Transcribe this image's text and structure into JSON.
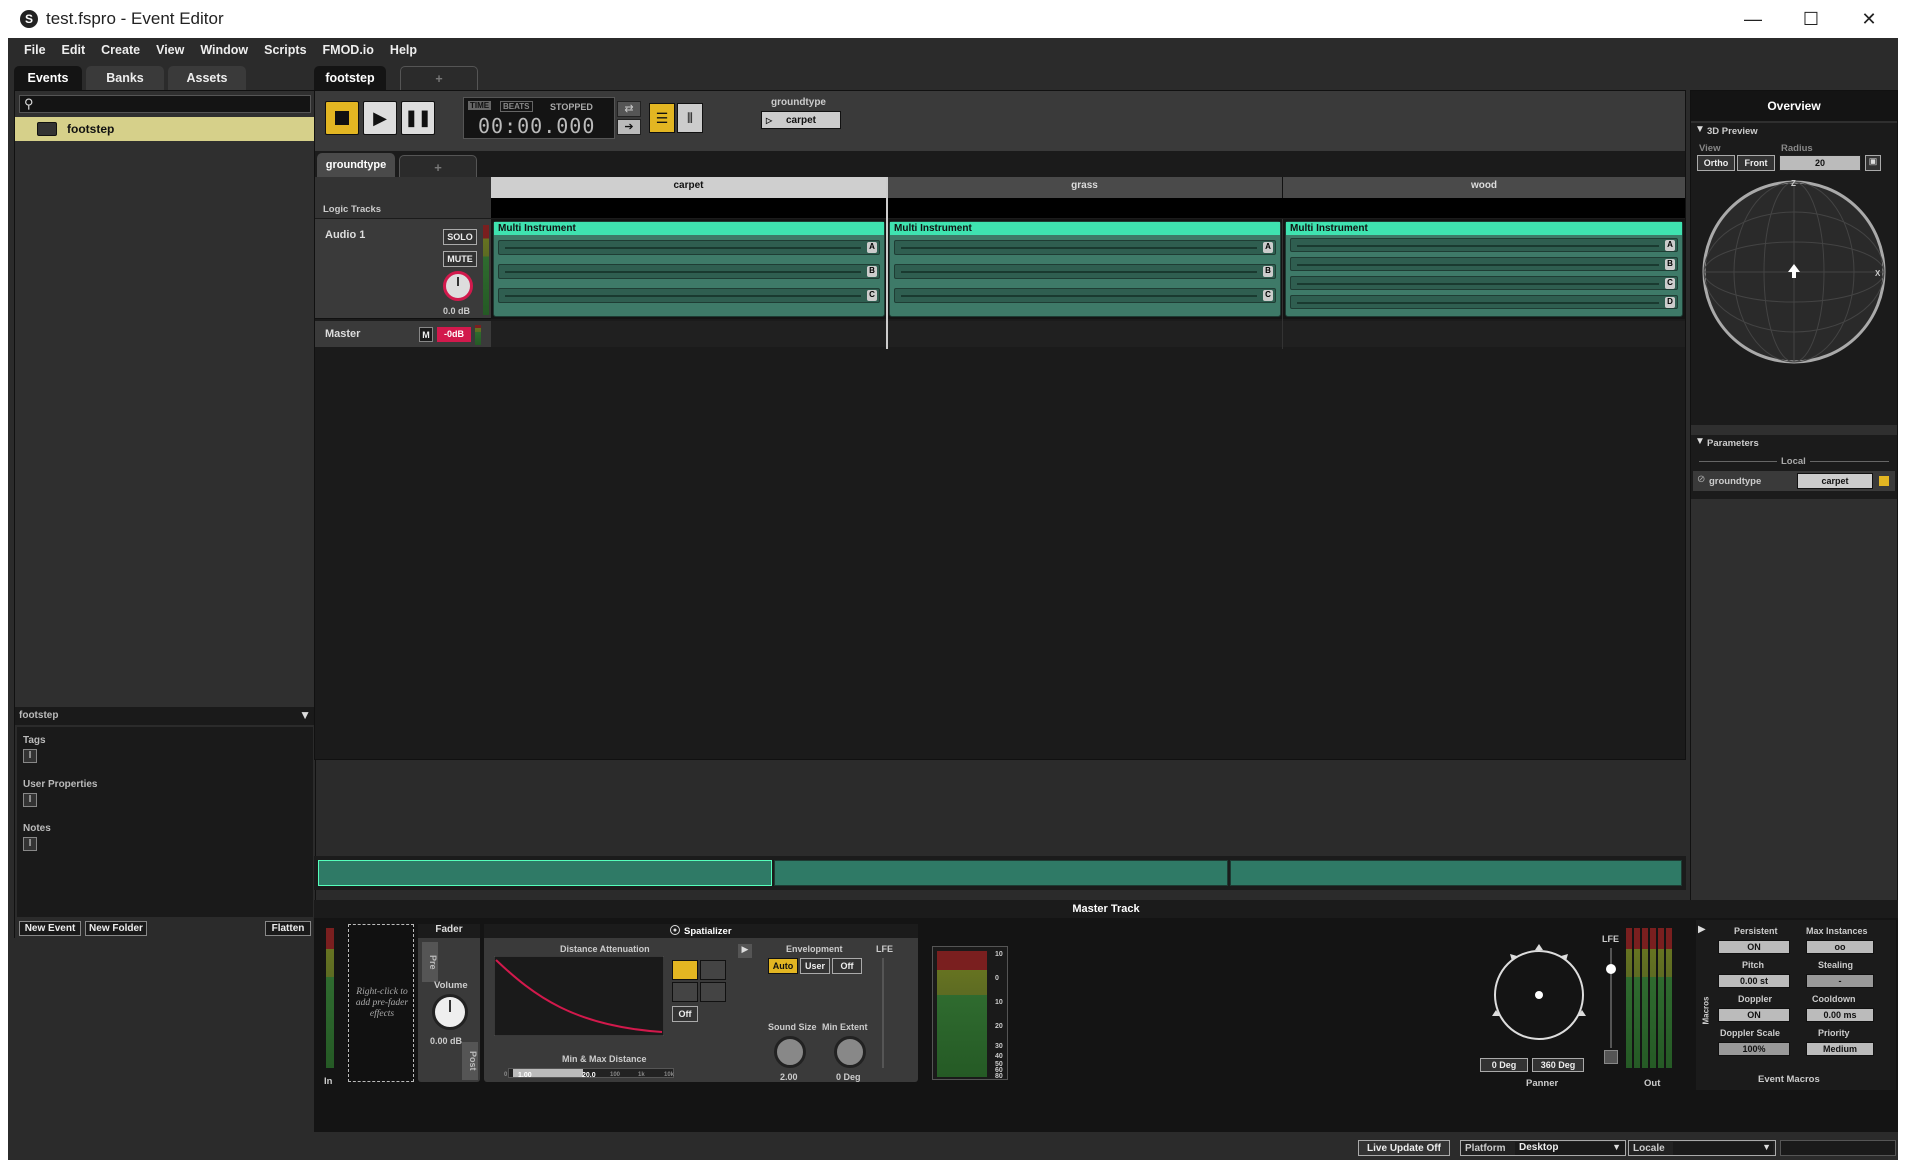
{
  "window": {
    "title": "test.fspro - Event Editor",
    "minimize": "—",
    "maximize": "☐",
    "close": "✕"
  },
  "menu": [
    "File",
    "Edit",
    "Create",
    "View",
    "Window",
    "Scripts",
    "FMOD.io",
    "Help"
  ],
  "browser": {
    "tabs": [
      "Events",
      "Banks",
      "Assets"
    ],
    "search_placeholder": "",
    "events": [
      {
        "name": "footstep"
      }
    ],
    "footer_title": "footstep",
    "sections": [
      "Tags",
      "User Properties",
      "Notes"
    ],
    "buttons": {
      "new_event": "New Event",
      "new_folder": "New Folder",
      "flatten": "Flatten"
    }
  },
  "editor": {
    "tab": "footstep",
    "add_tab": "+",
    "transport": {
      "time_label": "TIME",
      "beats_label": "BEATS",
      "state": "STOPPED",
      "time": "00:00.000"
    },
    "param_display": {
      "name": "groundtype",
      "value": "carpet"
    },
    "param_tab": "groundtype",
    "columns": [
      "carpet",
      "grass",
      "wood"
    ],
    "logic_tracks_label": "Logic Tracks",
    "tracks": {
      "audio1": {
        "name": "Audio 1",
        "solo": "SOLO",
        "mute": "MUTE",
        "volume": "0.0 dB"
      },
      "master": {
        "name": "Master",
        "m": "M",
        "value": "-0dB"
      }
    },
    "clips": [
      {
        "title": "Multi Instrument",
        "lanes": [
          "A",
          "B",
          "C"
        ]
      },
      {
        "title": "Multi Instrument",
        "lanes": [
          "A",
          "B",
          "C"
        ]
      },
      {
        "title": "Multi Instrument",
        "lanes": [
          "A",
          "B",
          "C",
          "D"
        ]
      }
    ]
  },
  "overview": {
    "title": "Overview",
    "preview": {
      "header": "3D Preview",
      "view_label": "View",
      "radius_label": "Radius",
      "ortho": "Ortho",
      "front": "Front",
      "radius": "20",
      "z": "Z",
      "x": "X"
    },
    "parameters": {
      "header": "Parameters",
      "local": "Local",
      "param_name": "groundtype",
      "param_value": "carpet"
    }
  },
  "master_track": {
    "title": "Master Track",
    "in_label": "In",
    "fx_hint": "Right-click to add pre-fader effects",
    "fader": {
      "title": "Fader",
      "pre": "Pre",
      "post": "Post",
      "volume_label": "Volume",
      "volume": "0.00 dB"
    },
    "spatializer": {
      "title": "Spatializer",
      "distance_attenuation": "Distance Attenuation",
      "off": "Off",
      "min_max": "Min & Max Distance",
      "min_value": "1.00",
      "max_value": "20.0",
      "scale": [
        "0",
        "1",
        "",
        "10",
        "100",
        "1k",
        "10k"
      ],
      "envelopment": "Envelopment",
      "env_options": [
        "Auto",
        "User",
        "Off"
      ],
      "lfe": "LFE",
      "sound_size_label": "Sound Size",
      "sound_size": "2.00",
      "min_extent_label": "Min Extent",
      "min_extent": "0 Deg",
      "db_scale": [
        "10",
        "0",
        "10",
        "20",
        "30",
        "40",
        "50",
        "60",
        "80"
      ]
    },
    "panner": {
      "label": "Panner",
      "lfe": "LFE",
      "deg1": "0 Deg",
      "deg2": "360 Deg"
    },
    "out_label": "Out",
    "macros": {
      "side_label": "Macros",
      "title": "Event Macros",
      "persistent": "Persistent",
      "persistent_val": "ON",
      "max_instances": "Max Instances",
      "max_instances_val": "oo",
      "pitch": "Pitch",
      "pitch_val": "0.00 st",
      "stealing": "Stealing",
      "stealing_val": "-",
      "doppler": "Doppler",
      "doppler_val": "ON",
      "cooldown": "Cooldown",
      "cooldown_val": "0.00 ms",
      "doppler_scale": "Doppler Scale",
      "doppler_scale_val": "100%",
      "priority": "Priority",
      "priority_val": "Medium"
    }
  },
  "status": {
    "live_update": "Live Update Off",
    "platform_label": "Platform",
    "platform": "Desktop",
    "locale_label": "Locale",
    "locale": ""
  },
  "colors": {
    "accent": "#3fe3b0",
    "highlight": "#d6d08a",
    "yellow": "#e3b622",
    "red": "#d2194c"
  }
}
